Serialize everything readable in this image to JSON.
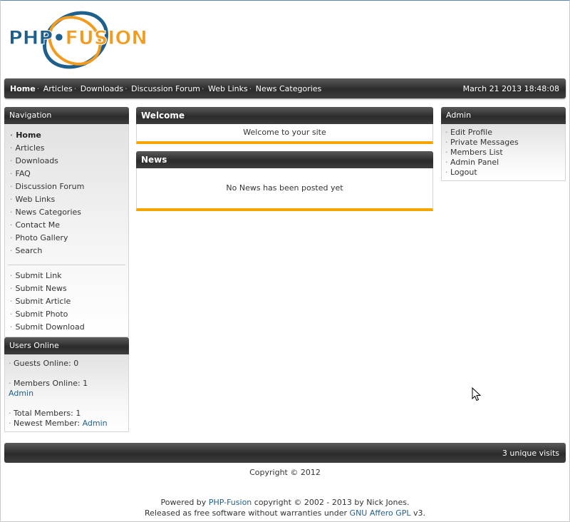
{
  "logo": {
    "part1": "PHP",
    "part2": "FUSION"
  },
  "topbar": {
    "links": [
      "Home",
      "Articles",
      "Downloads",
      "Discussion Forum",
      "Web Links",
      "News Categories"
    ],
    "date": "March 21 2013 18:48:08"
  },
  "navigation": {
    "title": "Navigation",
    "items": [
      "Home",
      "Articles",
      "Downloads",
      "FAQ",
      "Discussion Forum",
      "Web Links",
      "News Categories",
      "Contact Me",
      "Photo Gallery",
      "Search"
    ],
    "submit_items": [
      "Submit Link",
      "Submit News",
      "Submit Article",
      "Submit Photo",
      "Submit Download"
    ]
  },
  "users_online": {
    "title": "Users Online",
    "guests": "Guests Online: 0",
    "members": "Members Online: 1",
    "member_name": "Admin",
    "total": "Total Members: 1",
    "newest_label": "Newest Member:",
    "newest_name": "Admin"
  },
  "welcome": {
    "title": "Welcome",
    "text": "Welcome to your site"
  },
  "news": {
    "title": "News",
    "text": "No News has been posted yet"
  },
  "admin": {
    "title": "Admin",
    "items": [
      "Edit Profile",
      "Private Messages",
      "Members List",
      "Admin Panel",
      "Logout"
    ]
  },
  "footer": {
    "visits": "3 unique visits",
    "copyright": "Copyright © 2012",
    "powered_by": "Powered by",
    "php_fusion_link": "PHP-Fusion",
    "powered_rest": "copyright © 2002 - 2013 by Nick Jones.",
    "released": "Released as free software without warranties under",
    "license_link": "GNU Affero GPL",
    "license_version": "v3."
  },
  "colors": {
    "accent": "#f5a500",
    "link": "#1f5f8b",
    "bar": "#2b2b2b"
  }
}
